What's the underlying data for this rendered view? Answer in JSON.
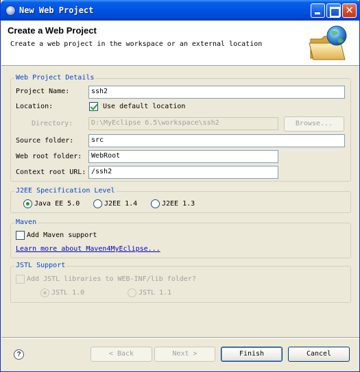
{
  "window": {
    "title": "New Web Project"
  },
  "banner": {
    "title": "Create a Web Project",
    "description": "Create a web project in the workspace or an external location",
    "icon": "folder-globe-icon"
  },
  "details": {
    "group_title": "Web Project Details",
    "project_name_label": "Project Name:",
    "project_name_value": "ssh2",
    "location_label": "Location:",
    "use_default_label": "Use default location",
    "use_default_checked": true,
    "directory_label": "Directory:",
    "directory_value": "D:\\MyEclipse 6.5\\workspace\\ssh2",
    "browse_label": "Browse...",
    "source_folder_label": "Source folder:",
    "source_folder_value": "src",
    "web_root_label": "Web root folder:",
    "web_root_value": "WebRoot",
    "context_root_label": "Context root URL:",
    "context_root_value": "/ssh2"
  },
  "j2ee": {
    "group_title": "J2EE Specification Level",
    "options": [
      "Java EE 5.0",
      "J2EE 1.4",
      "J2EE 1.3"
    ],
    "selected": "Java EE 5.0"
  },
  "maven": {
    "group_title": "Maven",
    "add_support_label": "Add Maven support",
    "add_support_checked": false,
    "learn_more_link": "Learn more about Maven4MyEclipse..."
  },
  "jstl": {
    "group_title": "JSTL Support",
    "add_libraries_label": "Add JSTL libraries to WEB-INF/lib folder?",
    "options": [
      "JSTL 1.0",
      "JSTL 1.1"
    ],
    "selected": "JSTL 1.0"
  },
  "buttons": {
    "back": "< Back",
    "next": "Next >",
    "finish": "Finish",
    "cancel": "Cancel"
  },
  "colors": {
    "titlebar": "#0054e3",
    "group_title": "#0046d5",
    "link": "#0000cc",
    "check": "#21a121"
  }
}
